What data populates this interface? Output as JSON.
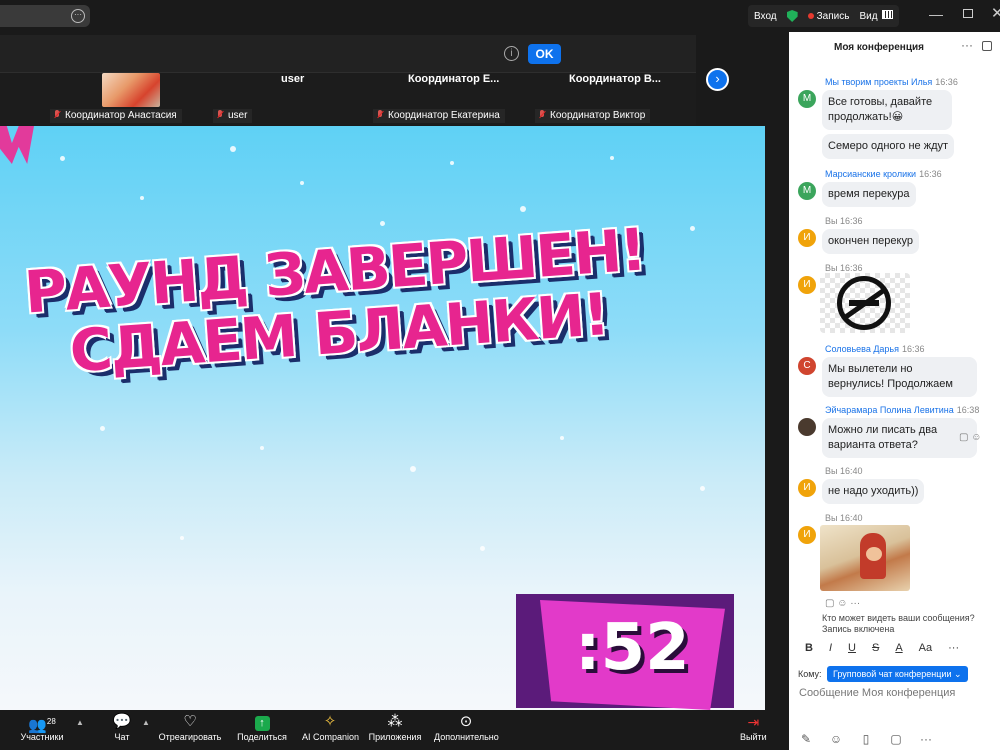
{
  "topbar": {
    "signin": "Вход",
    "record": "Запись",
    "view": "Вид"
  },
  "notification": {
    "ok_label": "OK",
    "info_icon": "i"
  },
  "participants_strip": {
    "tiles": [
      {
        "name": "",
        "label": "Координатор Анастасия"
      },
      {
        "name": "user",
        "label": "user"
      },
      {
        "name": "Координатор  E...",
        "label": "Координатор Екатерина"
      },
      {
        "name": "Координатор  В...",
        "label": "Координатор Виктор"
      }
    ]
  },
  "stage": {
    "headline_line1": "РАУНД ЗАВЕРШЕН!",
    "headline_line2": "СДАЕМ БЛАНКИ!",
    "timer": ":52"
  },
  "chat": {
    "title": "Моя конференция",
    "messages": [
      {
        "sender": "Мы творим проекты Илья",
        "time": "16:36",
        "avatar": "М",
        "avatar_color": "#3ba55c",
        "text": "Все готовы, давайте продолжать!😀"
      },
      {
        "text": "Семеро одного не ждут"
      },
      {
        "sender": "Марсианские кролики",
        "time": "16:36",
        "avatar": "М",
        "avatar_color": "#3ba55c",
        "text": "время перекура"
      },
      {
        "me": "Вы",
        "time": "16:36",
        "avatar": "И",
        "avatar_color": "#f0a30a",
        "text": "окончен перекур"
      },
      {
        "me": "Вы",
        "time": "16:36",
        "avatar": "И",
        "avatar_color": "#f0a30a",
        "text": ""
      },
      {
        "sender": "Соловьева Дарья",
        "time": "16:36",
        "avatar": "С",
        "avatar_color": "#d0452f",
        "text": "Мы вылетели но вернулись! Продолжаем"
      },
      {
        "sender": "Эйчарамара Полина Левитина",
        "time": "16:38",
        "text": "Можно ли писать два варианта ответа?"
      },
      {
        "me": "Вы",
        "time": "16:40",
        "avatar": "И",
        "avatar_color": "#f0a30a",
        "text": "не надо уходить))"
      },
      {
        "me": "Вы",
        "time": "16:40",
        "avatar": "И",
        "avatar_color": "#f0a30a",
        "text": ""
      }
    ],
    "privacy": "Кто может видеть ваши сообщения? Запись включена",
    "format_buttons": [
      "B",
      "I",
      "U",
      "S",
      "A",
      "Aa",
      "···"
    ],
    "to_label": "Кому:",
    "to_value": "Групповой чат конференции ⌄",
    "input_placeholder": "Сообщение Моя конференция"
  },
  "toolbar": {
    "participants": "Участники",
    "participants_count": "28",
    "chat": "Чат",
    "react": "Отреагировать",
    "share": "Поделиться",
    "ai": "AI Companion",
    "apps": "Приложения",
    "more": "Дополнительно",
    "leave": "Выйти"
  },
  "colors": {
    "accent": "#0e72ed",
    "headline": "#e7258f",
    "timer_bg": "#e23ac9"
  }
}
